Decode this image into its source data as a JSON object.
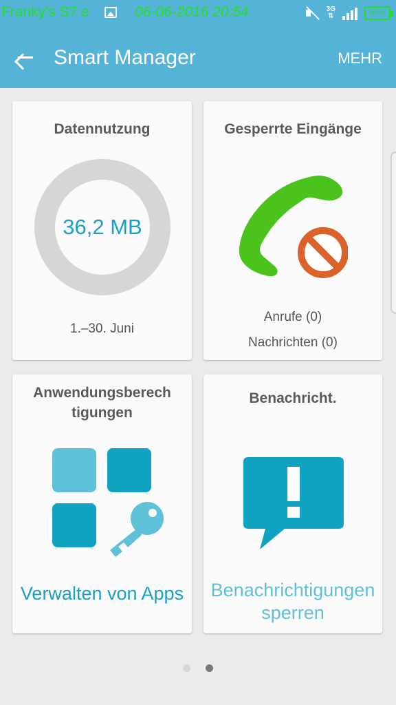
{
  "status_bar": {
    "left_text": "Franky's S7 e",
    "time": "06-06-2016 20:54",
    "network": "3G",
    "battery": "95%"
  },
  "app_bar": {
    "title": "Smart Manager",
    "more_label": "MEHR"
  },
  "cards": {
    "data_usage": {
      "title": "Datennutzung",
      "value": "36,2 MB",
      "period": "1.–30. Juni"
    },
    "blocked": {
      "title": "Gesperrte Eingänge",
      "calls": "Anrufe (0)",
      "messages": "Nachrichten (0)"
    },
    "permissions": {
      "title_line1": "Anwendungsberech",
      "title_line2": "tigungen",
      "action": "Verwalten von Apps"
    },
    "notifications": {
      "title": "Benachricht.",
      "action_line1": "Benachrichtigungen",
      "action_line2": "sperren"
    }
  },
  "pager": {
    "count": 2,
    "active": 1
  },
  "colors": {
    "app_bar": "#56b3d8",
    "accent": "#1aa0c4",
    "phone_green": "#4cc21c",
    "block_orange": "#d9632a"
  }
}
